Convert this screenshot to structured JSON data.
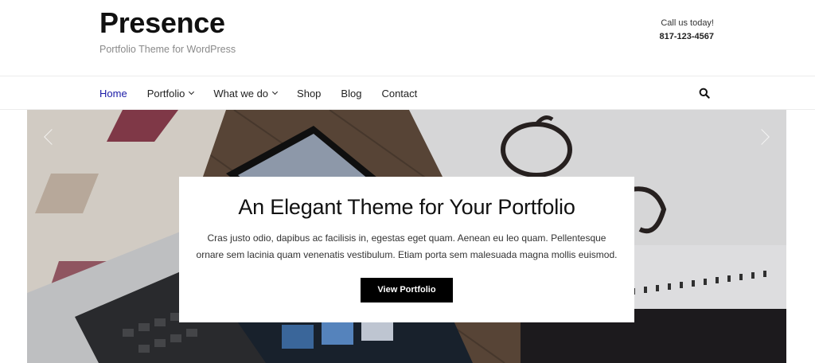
{
  "site": {
    "title": "Presence",
    "tagline": "Portfolio Theme for WordPress",
    "call_label": "Call us today!",
    "phone": "817-123-4567"
  },
  "nav": {
    "items": [
      {
        "label": "Home",
        "active": true,
        "dropdown": false
      },
      {
        "label": "Portfolio",
        "active": false,
        "dropdown": true
      },
      {
        "label": "What we do",
        "active": false,
        "dropdown": true
      },
      {
        "label": "Shop",
        "active": false,
        "dropdown": false
      },
      {
        "label": "Blog",
        "active": false,
        "dropdown": false
      },
      {
        "label": "Contact",
        "active": false,
        "dropdown": false
      }
    ],
    "search_icon": "search-icon",
    "active_color": "#1a1aa6"
  },
  "hero": {
    "heading": "An Elegant Theme for Your Portfolio",
    "text": "Cras justo odio, dapibus ac facilisis in, egestas eget quam. Aenean eu leo quam. Pellentesque ornare sem lacinia quam venenatis vestibulum. Etiam porta sem malesuada magna mollis euismod.",
    "button_label": "View Portfolio",
    "prev_icon": "chevron-left-icon",
    "next_icon": "chevron-right-icon"
  }
}
